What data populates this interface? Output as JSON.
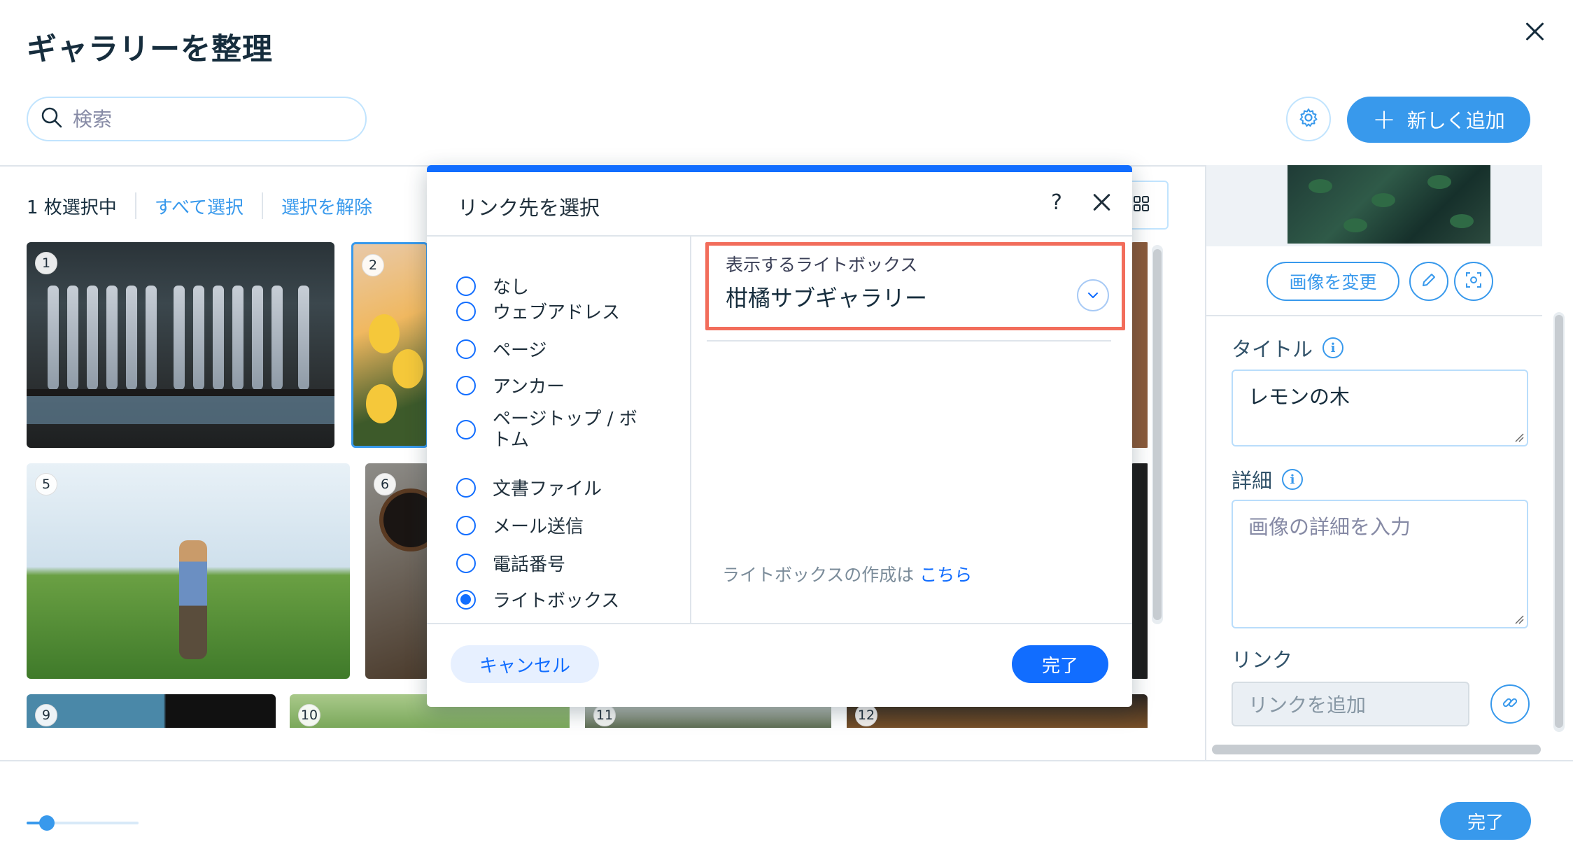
{
  "header": {
    "title": "ギャラリーを整理",
    "search_placeholder": "検索",
    "add_button_label": "新しく追加"
  },
  "selection_bar": {
    "count_label": "1 枚選択中",
    "select_all_label": "すべて選択",
    "deselect_label": "選択を解除"
  },
  "grid": {
    "thumbnails": [
      {
        "number": "1"
      },
      {
        "number": "2"
      },
      {
        "number": "5"
      },
      {
        "number": "6"
      },
      {
        "number": "9"
      },
      {
        "number": "10"
      },
      {
        "number": "11"
      },
      {
        "number": "12"
      }
    ]
  },
  "modal": {
    "title": "リンク先を選択",
    "help_label": "?",
    "options": [
      {
        "label": "なし",
        "selected": false
      },
      {
        "label": "ウェブアドレス",
        "selected": false
      },
      {
        "label": "ページ",
        "selected": false
      },
      {
        "label": "アンカー",
        "selected": false
      },
      {
        "label": "ページトップ / ボトム",
        "selected": false
      },
      {
        "label": "文書ファイル",
        "selected": false
      },
      {
        "label": "メール送信",
        "selected": false
      },
      {
        "label": "電話番号",
        "selected": false
      },
      {
        "label": "ライトボックス",
        "selected": true
      }
    ],
    "lightbox_field_label": "表示するライトボックス",
    "lightbox_selected": "柑橘サブギャラリー",
    "create_prompt": "ライトボックスの作成は",
    "create_link": "こちら",
    "cancel_label": "キャンセル",
    "done_label": "完了"
  },
  "right_panel": {
    "change_image_label": "画像を変更",
    "title_label": "タイトル",
    "title_value": "レモンの木",
    "detail_label": "詳細",
    "detail_placeholder": "画像の詳細を入力",
    "link_label": "リンク",
    "link_placeholder": "リンクを追加"
  },
  "footer": {
    "done_label": "完了",
    "thumbnail_size_level": 0.18
  },
  "colors": {
    "accent": "#3899ec",
    "modal_accent": "#116dff",
    "highlight_border": "#f26d5b"
  }
}
